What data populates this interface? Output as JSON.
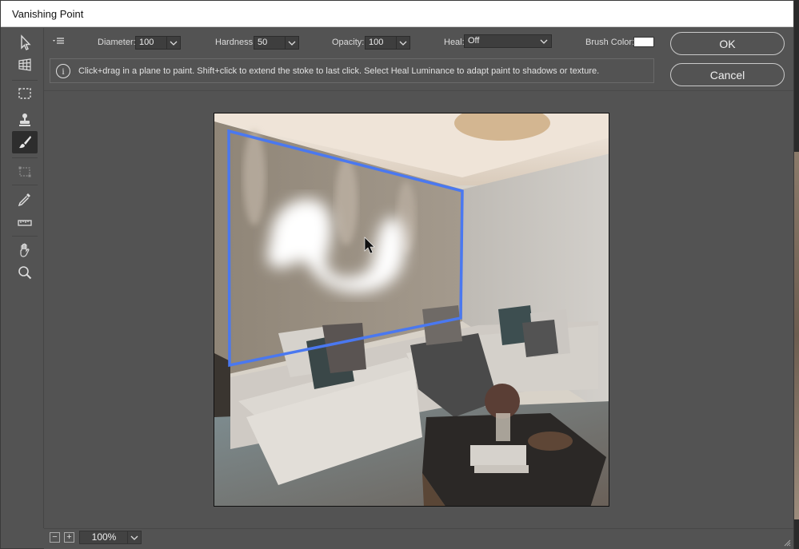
{
  "window": {
    "title": "Vanishing Point"
  },
  "toolbar": {
    "tools": [
      {
        "name": "edit-plane-tool",
        "icon": "arrow-pointer-icon"
      },
      {
        "name": "create-plane-tool",
        "icon": "grid-plane-icon"
      },
      {
        "name": "marquee-tool",
        "icon": "dashed-rectangle-icon"
      },
      {
        "name": "stamp-tool",
        "icon": "stamp-icon"
      },
      {
        "name": "brush-tool",
        "icon": "brush-icon",
        "active": true
      },
      {
        "name": "transform-tool",
        "icon": "transform-icon"
      },
      {
        "name": "eyedropper-tool",
        "icon": "eyedropper-icon"
      },
      {
        "name": "measure-tool",
        "icon": "ruler-icon"
      },
      {
        "name": "hand-tool",
        "icon": "hand-icon"
      },
      {
        "name": "zoom-tool",
        "icon": "magnifier-icon"
      }
    ]
  },
  "options": {
    "diameter_label": "Diameter:",
    "diameter_value": "100",
    "hardness_label": "Hardness:",
    "hardness_value": "50",
    "opacity_label": "Opacity:",
    "opacity_value": "100",
    "heal_label": "Heal:",
    "heal_value": "Off",
    "brush_color_label": "Brush Color:",
    "brush_color": "#ffffff"
  },
  "info": {
    "message": "Click+drag in a plane to paint. Shift+click to extend the stoke to last click. Select Heal Luminance to adapt paint to shadows or texture."
  },
  "buttons": {
    "ok": "OK",
    "cancel": "Cancel"
  },
  "status": {
    "zoom": "100%"
  },
  "colors": {
    "plane_outline": "#4a78f0",
    "panel": "#535353"
  }
}
